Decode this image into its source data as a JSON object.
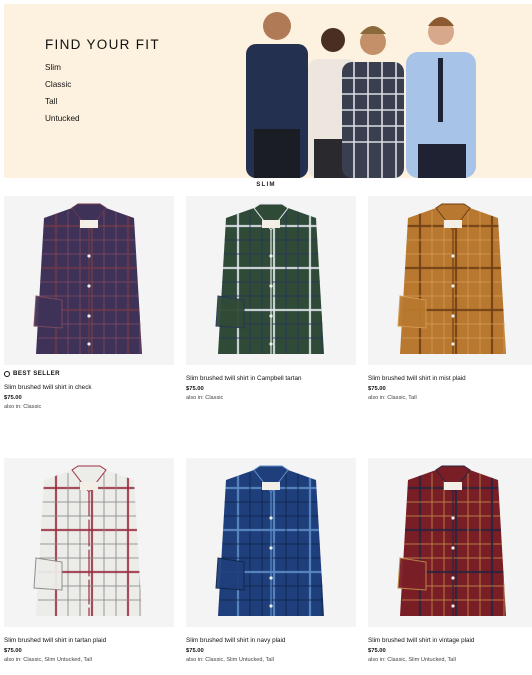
{
  "hero": {
    "title": "FIND YOUR FIT",
    "links": [
      "Slim",
      "Classic",
      "Tall",
      "Untucked"
    ]
  },
  "section_label": "SLIM",
  "colors": {
    "hero_bg": "#fdf1df",
    "text": "#111111",
    "card_bg": "#f4f4f4"
  },
  "products": [
    {
      "name": "Slim brushed twill shirt in check",
      "price": "$75.00",
      "also": "also in: Classic",
      "badge": "BEST SELLER",
      "badge_icon": "outline-circle-icon",
      "palette": [
        "#3f3258",
        "#6c3a4a",
        "#7d4a60"
      ]
    },
    {
      "name": "Slim brushed twill shirt in Campbell tartan",
      "price": "$75.00",
      "also": "also in: Classic",
      "badge": "",
      "palette": [
        "#2f4a36",
        "#e4e8ef",
        "#26355a"
      ]
    },
    {
      "name": "Slim brushed twill shirt in mist plaid",
      "price": "$75.00",
      "also": "also in: Classic, Tall",
      "badge": "",
      "palette": [
        "#b8782f",
        "#6e3e16",
        "#d39a52"
      ]
    },
    {
      "name": "Slim brushed twill shirt in tartan plaid",
      "price": "$75.00",
      "also": "also in: Classic, Slim Untucked, Tall",
      "badge": "",
      "palette": [
        "#ecece9",
        "#9a3040",
        "#8a8a8a"
      ]
    },
    {
      "name": "Slim brushed twill shirt in navy plaid",
      "price": "$75.00",
      "also": "also in: Classic, Slim Untucked, Tall",
      "badge": "",
      "palette": [
        "#1f3f7c",
        "#5f8fc8",
        "#102648"
      ]
    },
    {
      "name": "Slim brushed twill shirt in vintage plaid",
      "price": "$75.00",
      "also": "also in: Classic, Slim Untucked, Tall",
      "badge": "",
      "palette": [
        "#7a1e26",
        "#2a2440",
        "#c08a4a"
      ]
    }
  ]
}
